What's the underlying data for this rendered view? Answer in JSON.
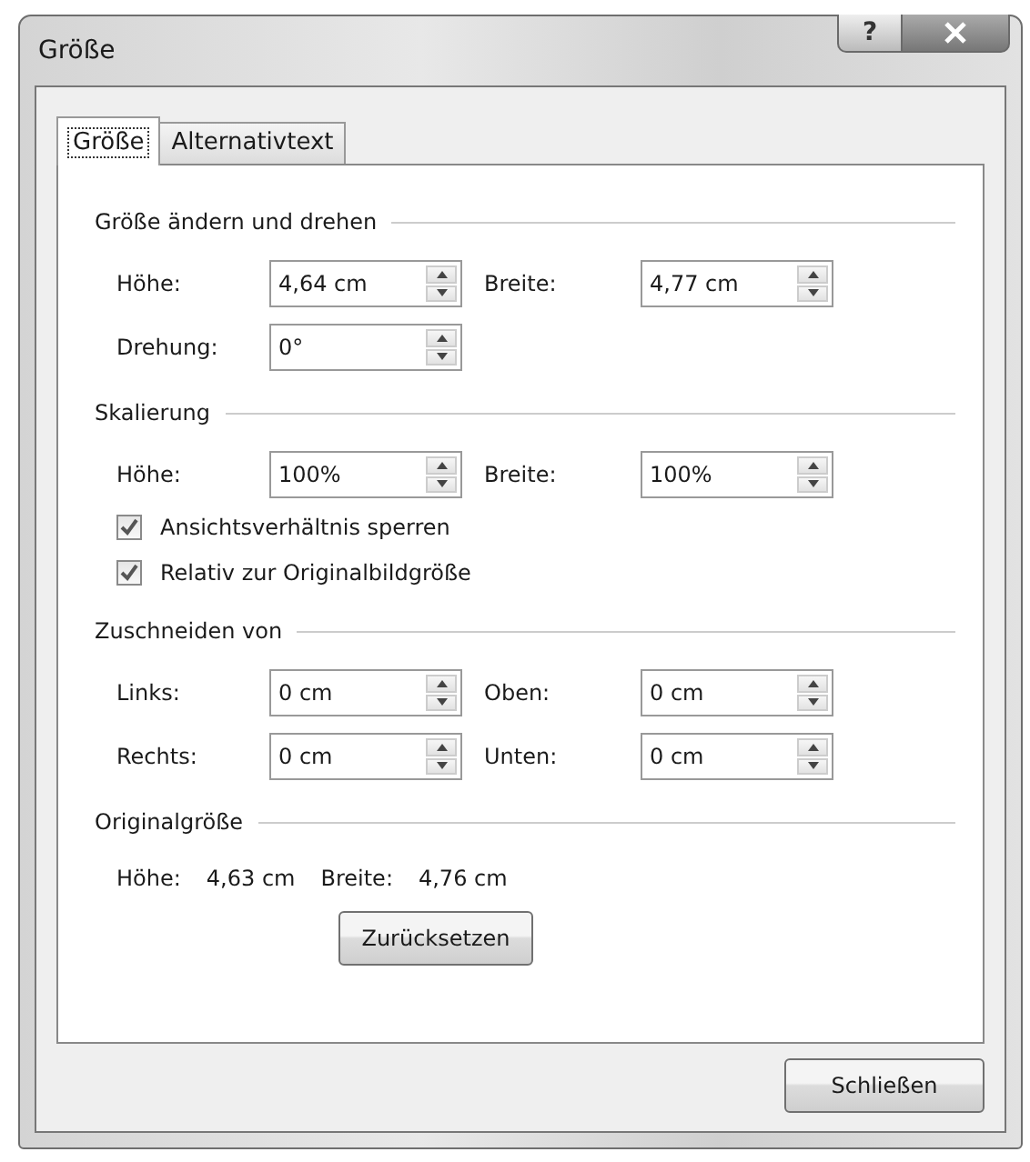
{
  "window": {
    "title": "Größe"
  },
  "title_buttons": [
    {
      "kind": "help",
      "label": "?"
    },
    {
      "kind": "close"
    }
  ],
  "tabs": [
    {
      "label": "Größe",
      "selected": true
    },
    {
      "label": "Alternativtext",
      "selected": false
    }
  ],
  "sections": [
    {
      "title": "Größe ändern und drehen",
      "items": [
        {
          "kind": "spinrow",
          "fields": [
            {
              "label": "Höhe:",
              "value": "4,64 cm"
            },
            {
              "label": "Breite:",
              "value": "4,77 cm"
            }
          ]
        },
        {
          "kind": "spinrow",
          "fields": [
            {
              "label": "Drehung:",
              "value": "0°"
            }
          ]
        }
      ]
    },
    {
      "title": "Skalierung",
      "items": [
        {
          "kind": "spinrow",
          "fields": [
            {
              "label": "Höhe:",
              "value": "100%"
            },
            {
              "label": "Breite:",
              "value": "100%"
            }
          ]
        },
        {
          "kind": "checkbox",
          "label": "Ansichtsverhältnis sperren",
          "checked": true
        },
        {
          "kind": "checkbox",
          "label": "Relativ zur Originalbildgröße",
          "checked": true
        }
      ]
    },
    {
      "title": "Zuschneiden von",
      "items": [
        {
          "kind": "spinrow",
          "fields": [
            {
              "label": "Links:",
              "value": "0 cm"
            },
            {
              "label": "Oben:",
              "value": "0 cm"
            }
          ]
        },
        {
          "kind": "spinrow",
          "fields": [
            {
              "label": "Rechts:",
              "value": "0 cm"
            },
            {
              "label": "Unten:",
              "value": "0 cm"
            }
          ]
        }
      ]
    },
    {
      "title": "Originalgröße",
      "items": [
        {
          "kind": "info",
          "fields": [
            {
              "label": "Höhe:",
              "value": "4,63 cm"
            },
            {
              "label": "Breite:",
              "value": "4,76 cm"
            }
          ]
        },
        {
          "kind": "button",
          "label": "Zurücksetzen"
        }
      ]
    }
  ],
  "footer_buttons": [
    "Schließen"
  ]
}
